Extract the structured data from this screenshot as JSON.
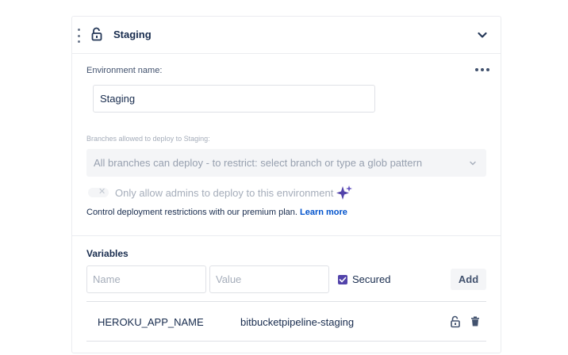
{
  "header": {
    "title": "Staging",
    "icons": {
      "drag": "drag-handle-icon",
      "lock": "unlock-icon",
      "collapse": "chevron-down-icon"
    }
  },
  "environment": {
    "name_label": "Environment name:",
    "name_value": "Staging",
    "more_icon": "more-icon"
  },
  "branches": {
    "label": "Branches allowed to deploy to Staging:",
    "placeholder": "All branches can deploy - to restrict: select branch or type a glob pattern"
  },
  "admin_toggle": {
    "label": "Only allow admins to deploy to this environment",
    "enabled": false
  },
  "premium": {
    "text": "Control deployment restrictions with our premium plan.",
    "link": "Learn more"
  },
  "variables": {
    "title": "Variables",
    "name_placeholder": "Name",
    "value_placeholder": "Value",
    "secured_label": "Secured",
    "secured_checked": true,
    "add_label": "Add",
    "rows": [
      {
        "name": "HEROKU_APP_NAME",
        "value": "bitbucketpipeline-staging"
      }
    ]
  },
  "colors": {
    "accent_purple": "#5243aa",
    "link_blue": "#0052cc",
    "sparkle_purple": "#6554c0"
  }
}
